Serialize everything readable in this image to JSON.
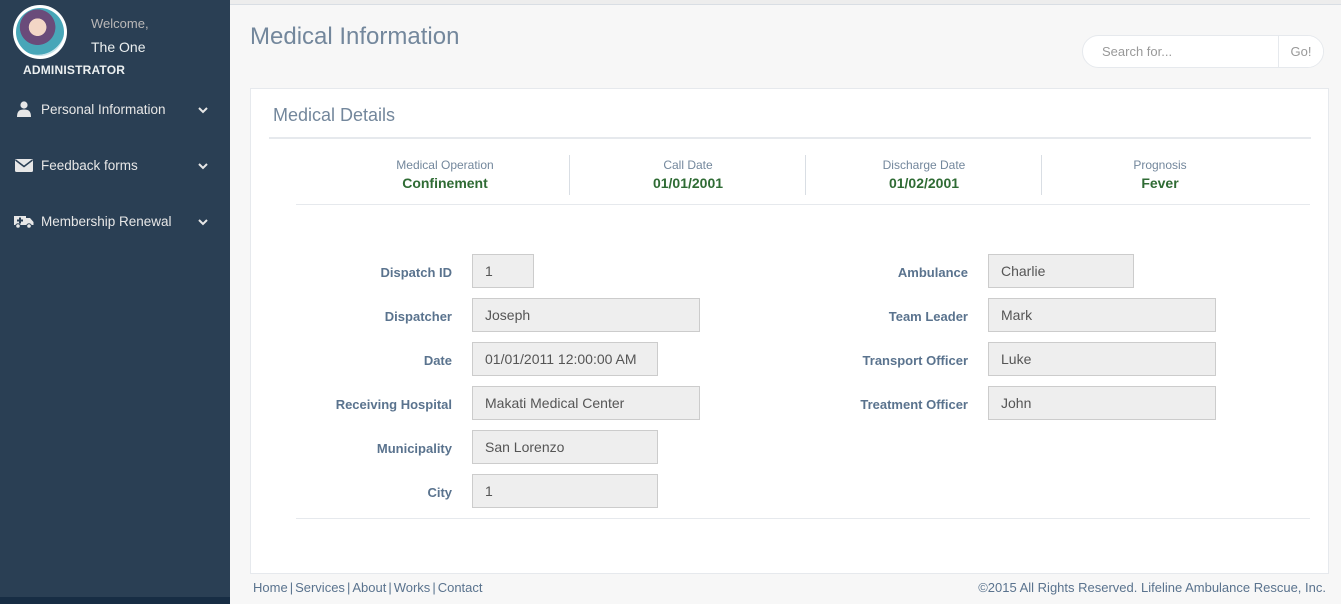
{
  "sidebar": {
    "welcome": "Welcome,",
    "username": "The One",
    "role": "ADMINISTRATOR",
    "items": [
      {
        "label": "Personal Information",
        "icon": "user-icon"
      },
      {
        "label": "Feedback forms",
        "icon": "envelope-icon"
      },
      {
        "label": "Membership Renewal",
        "icon": "ambulance-icon"
      }
    ]
  },
  "header": {
    "title": "Medical Information",
    "search_placeholder": "Search for...",
    "search_button": "Go!"
  },
  "panel": {
    "title": "Medical Details",
    "stats": [
      {
        "label": "Medical Operation",
        "value": "Confinement"
      },
      {
        "label": "Call Date",
        "value": "01/01/2001"
      },
      {
        "label": "Discharge Date",
        "value": "01/02/2001"
      },
      {
        "label": "Prognosis",
        "value": "Fever"
      }
    ],
    "left_fields": [
      {
        "label": "Dispatch ID",
        "value": "1"
      },
      {
        "label": "Dispatcher",
        "value": "Joseph"
      },
      {
        "label": "Date",
        "value": "01/01/2011 12:00:00 AM"
      },
      {
        "label": "Receiving Hospital",
        "value": "Makati Medical Center"
      },
      {
        "label": "Municipality",
        "value": "San Lorenzo"
      },
      {
        "label": "City",
        "value": "1"
      }
    ],
    "right_fields": [
      {
        "label": "Ambulance",
        "value": "Charlie"
      },
      {
        "label": "Team Leader",
        "value": "Mark"
      },
      {
        "label": "Transport Officer",
        "value": "Luke"
      },
      {
        "label": "Treatment Officer",
        "value": "John"
      }
    ]
  },
  "footer": {
    "links": [
      "Home",
      "Services",
      "About",
      "Works",
      "Contact"
    ],
    "separator": "|",
    "copyright": "©2015 All Rights Reserved. Lifeline Ambulance Rescue, Inc."
  },
  "colors": {
    "sidebar_bg": "#2A3F54",
    "stat_value": "#2f6b34",
    "label_text": "#5A738E"
  }
}
